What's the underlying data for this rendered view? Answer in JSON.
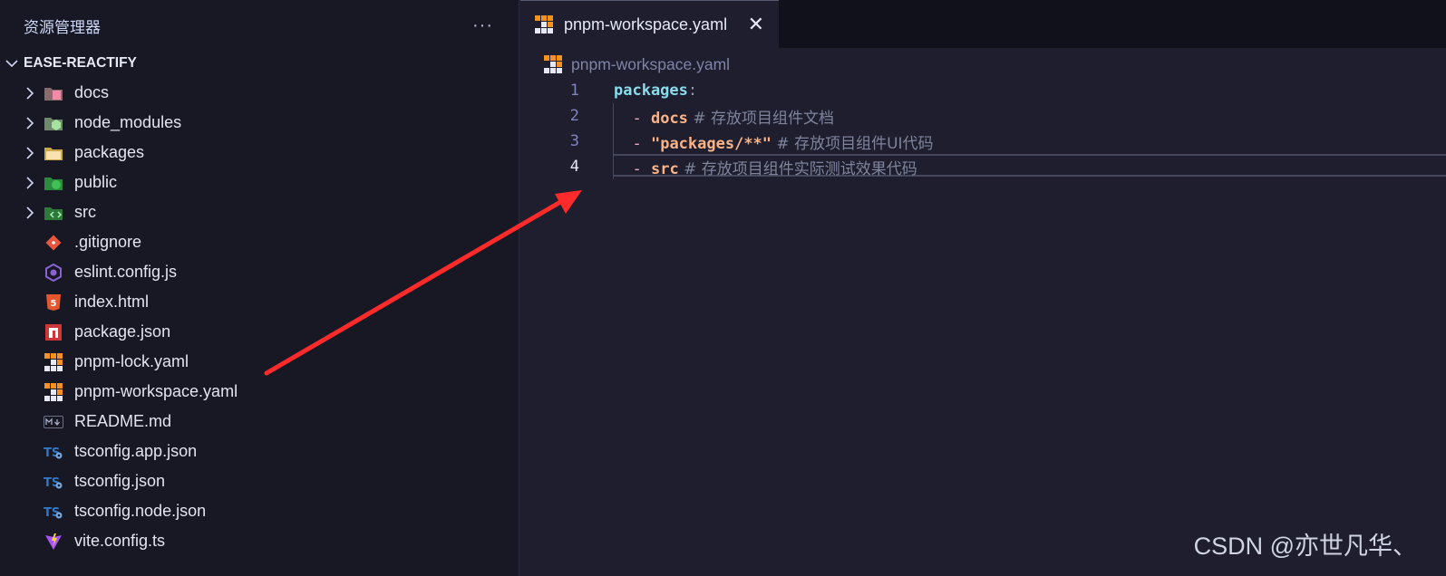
{
  "explorer": {
    "title": "资源管理器",
    "more_label": "···",
    "project_name": "EASE-REACTIFY",
    "items": [
      {
        "label": "docs",
        "type": "folder",
        "icon": "folder-docs-icon",
        "color": "#f38ba8"
      },
      {
        "label": "node_modules",
        "type": "folder",
        "icon": "folder-node-icon",
        "color": "#a6e3a1"
      },
      {
        "label": "packages",
        "type": "folder",
        "icon": "folder-packages-icon",
        "color": "#f9e2af"
      },
      {
        "label": "public",
        "type": "folder",
        "icon": "folder-public-icon",
        "color": "#40c057"
      },
      {
        "label": "src",
        "type": "folder",
        "icon": "folder-src-icon",
        "color": "#2f9e44"
      },
      {
        "label": ".gitignore",
        "type": "file",
        "icon": "git-icon",
        "color": "#e8573c"
      },
      {
        "label": "eslint.config.js",
        "type": "file",
        "icon": "eslint-icon",
        "color": "#8a63d2"
      },
      {
        "label": "index.html",
        "type": "file",
        "icon": "html-icon",
        "color": "#e4572e"
      },
      {
        "label": "package.json",
        "type": "file",
        "icon": "npm-icon",
        "color": "#cb3837"
      },
      {
        "label": "pnpm-lock.yaml",
        "type": "file",
        "icon": "pnpm-icon",
        "color": "#f69220"
      },
      {
        "label": "pnpm-workspace.yaml",
        "type": "file",
        "icon": "pnpm-icon",
        "color": "#f69220"
      },
      {
        "label": "README.md",
        "type": "file",
        "icon": "markdown-icon",
        "color": "#6c7086"
      },
      {
        "label": "tsconfig.app.json",
        "type": "file",
        "icon": "tsconfig-icon",
        "color": "#3178c6"
      },
      {
        "label": "tsconfig.json",
        "type": "file",
        "icon": "tsconfig-icon",
        "color": "#3178c6"
      },
      {
        "label": "tsconfig.node.json",
        "type": "file",
        "icon": "tsconfig-icon",
        "color": "#3178c6"
      },
      {
        "label": "vite.config.ts",
        "type": "file",
        "icon": "vite-icon",
        "color": "#a855f7"
      }
    ]
  },
  "editor": {
    "tab_label": "pnpm-workspace.yaml",
    "close_label": "✕",
    "breadcrumb": "pnpm-workspace.yaml",
    "lines": [
      {
        "num": "1",
        "key": "packages",
        "punct": ":",
        "dash": "",
        "value": "",
        "comment": ""
      },
      {
        "num": "2",
        "key": "",
        "punct": "",
        "dash": "- ",
        "value": "docs",
        "comment": " # 存放项目组件文档"
      },
      {
        "num": "3",
        "key": "",
        "punct": "",
        "dash": "- ",
        "value": "\"packages/**\"",
        "comment": " # 存放项目组件UI代码"
      },
      {
        "num": "4",
        "key": "",
        "punct": "",
        "dash": "- ",
        "value": "src",
        "comment": " # 存放项目组件实际测试效果代码"
      }
    ],
    "active_line": "4"
  },
  "watermark": "CSDN @亦世凡华、",
  "colors": {
    "arrow": "#ff2a2a",
    "pnpm": "#f69220"
  }
}
